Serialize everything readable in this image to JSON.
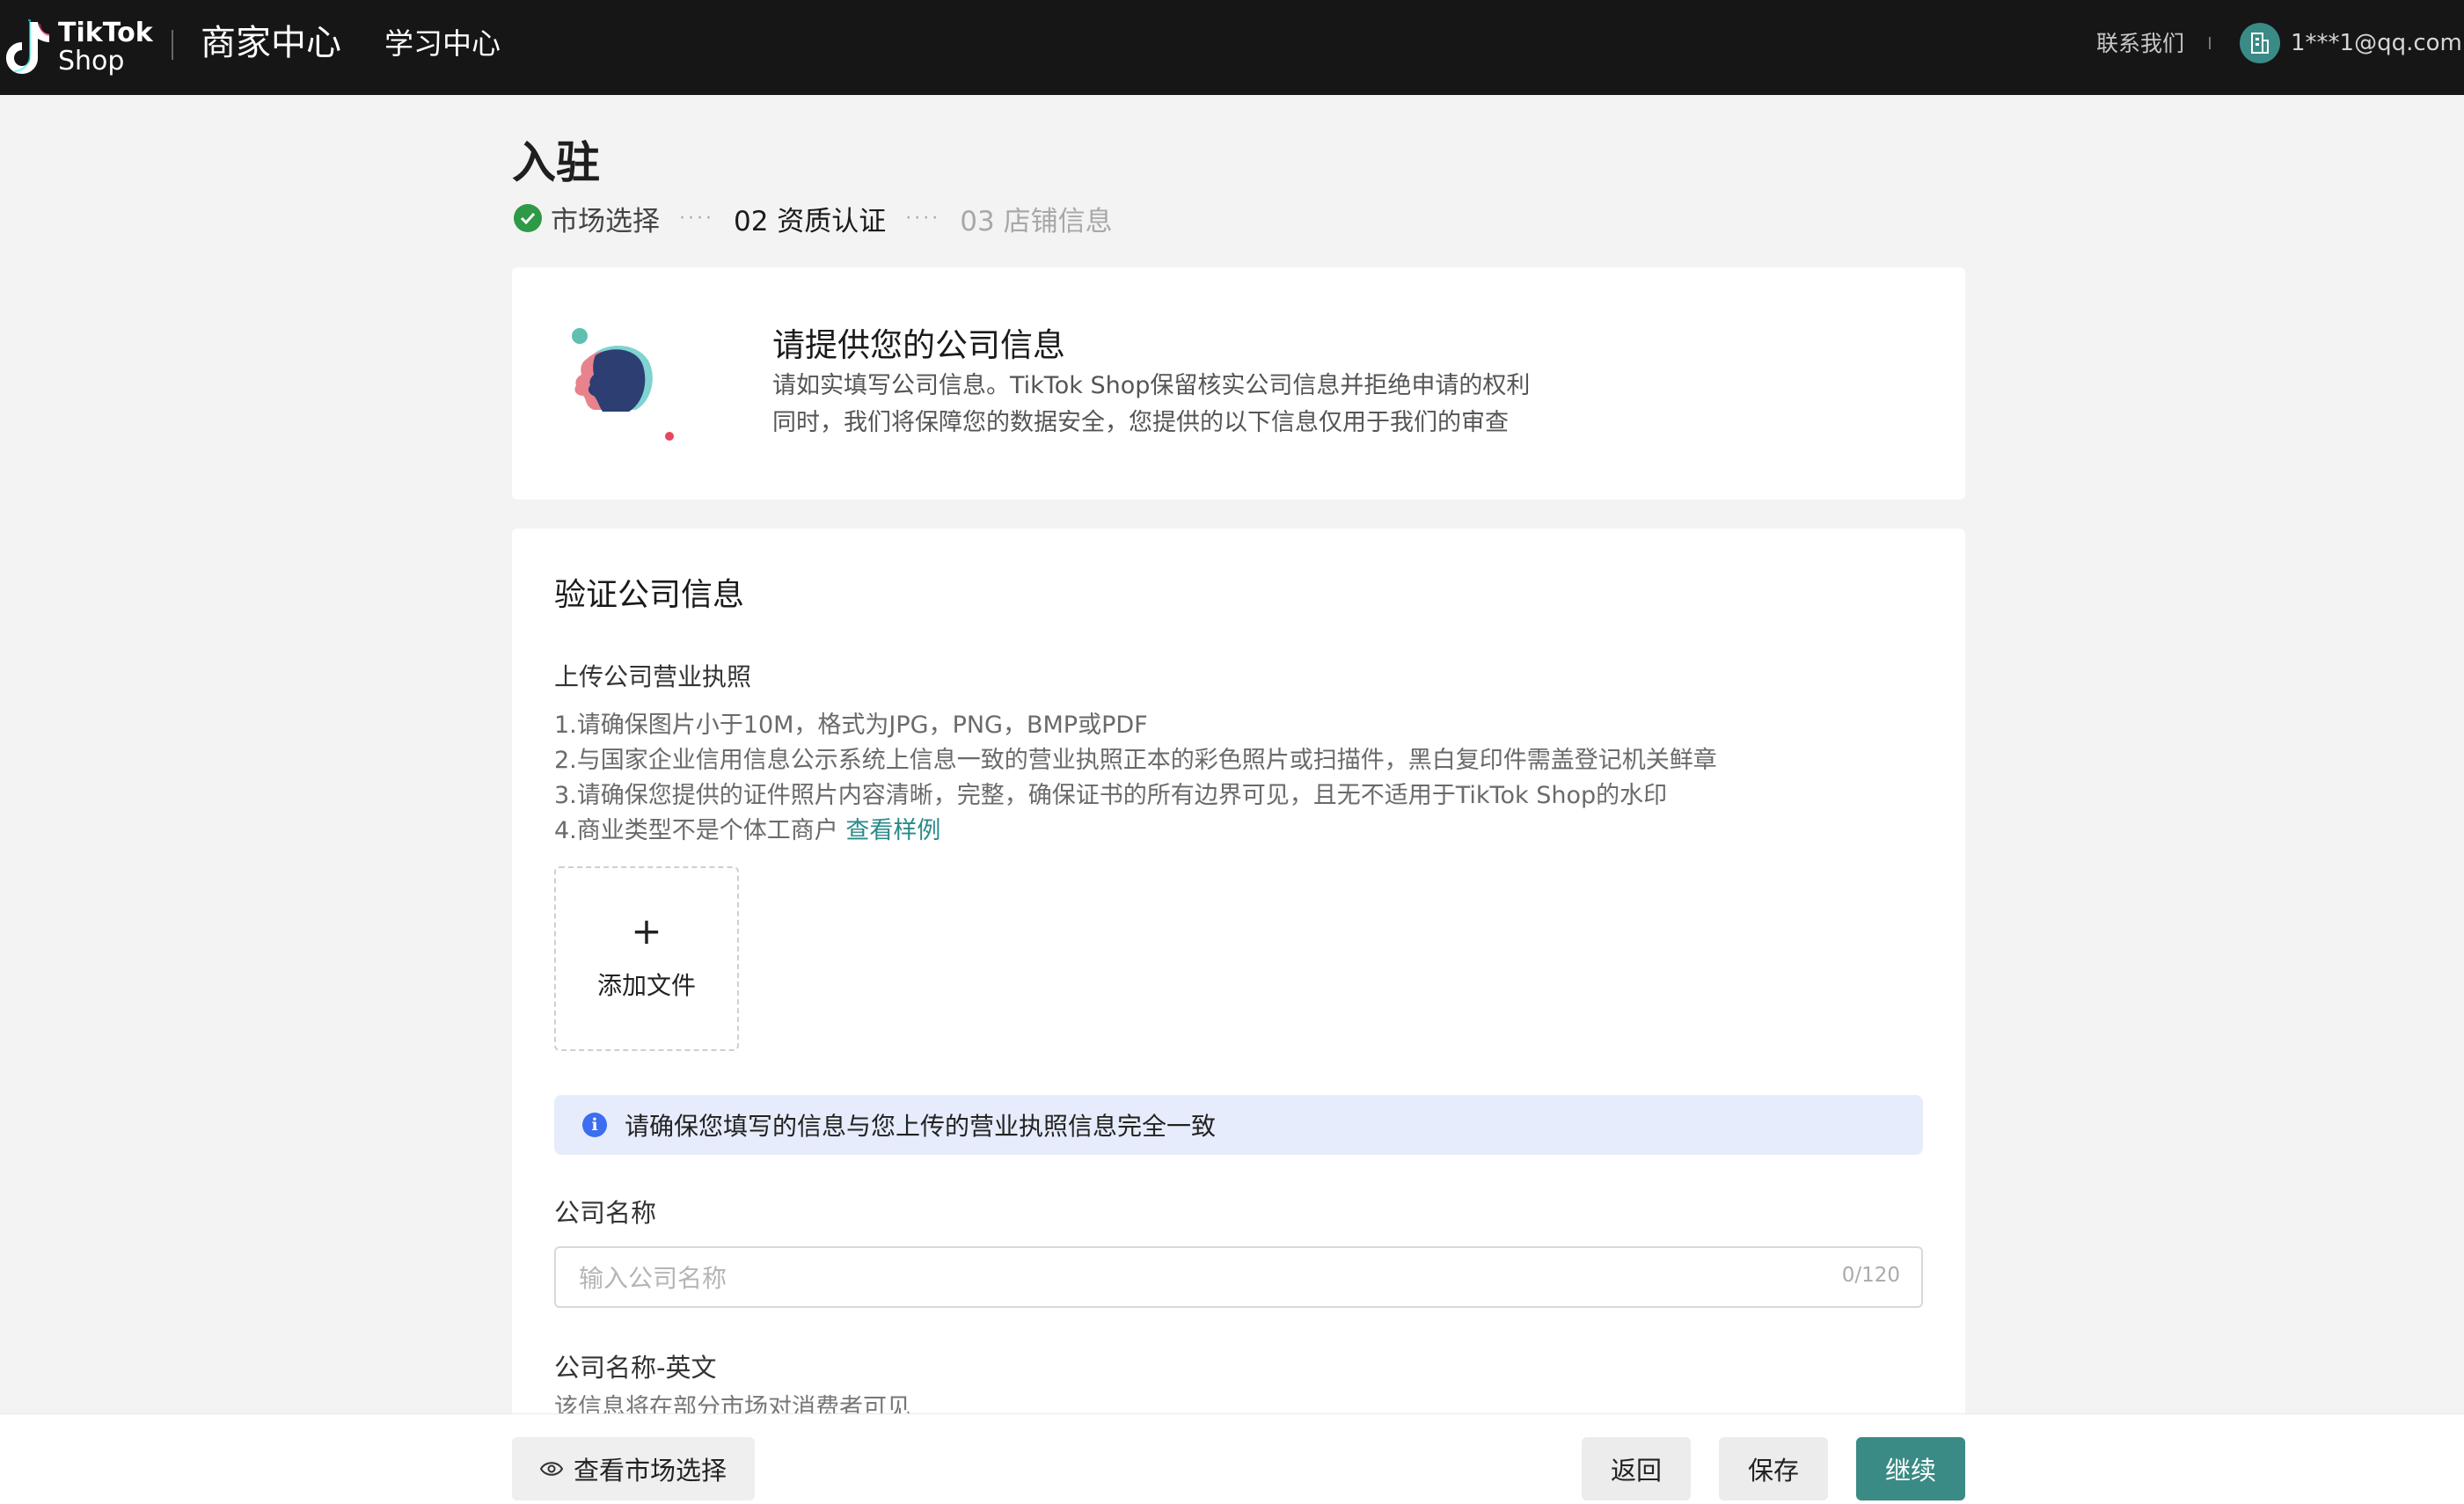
{
  "nav": {
    "logo_line1": "TikTok",
    "logo_line2": "Shop",
    "title": "商家中心",
    "learning_center": "学习中心",
    "contact": "联系我们",
    "account_email": "1***1@qq.com"
  },
  "page": {
    "title": "入驻",
    "steps": [
      {
        "label": "市场选择",
        "status": "done"
      },
      {
        "label": "02 资质认证",
        "status": "active"
      },
      {
        "label": "03 店铺信息",
        "status": "pending"
      }
    ],
    "step_separator": "····"
  },
  "intro": {
    "title": "请提供您的公司信息",
    "line1": "请如实填写公司信息。TikTok Shop保留核实公司信息并拒绝申请的权利",
    "line2": "同时，我们将保障您的数据安全，您提供的以下信息仅用于我们的审查"
  },
  "form": {
    "section_title": "验证公司信息",
    "upload_label": "上传公司营业执照",
    "requirements": [
      "1.请确保图片小于10M，格式为JPG，PNG，BMP或PDF",
      "2.与国家企业信用信息公示系统上信息一致的营业执照正本的彩色照片或扫描件，黑白复印件需盖登记机关鲜章",
      "3.请确保您提供的证件照片内容清晰，完整，确保证书的所有边界可见，且无不适用于TikTok Shop的水印",
      "4.商业类型不是个体工商户 "
    ],
    "sample_link": "查看样例",
    "upload_plus": "+",
    "upload_button": "添加文件",
    "notice": "请确保您填写的信息与您上传的营业执照信息完全一致",
    "company_name_label": "公司名称",
    "company_name_placeholder": "输入公司名称",
    "company_name_value": "",
    "company_name_counter": "0/120",
    "company_name_en_label": "公司名称-英文",
    "company_name_en_hint": "该信息将在部分市场对消费者可见"
  },
  "footer": {
    "view_market": "查看市场选择",
    "back": "返回",
    "save": "保存",
    "continue": "继续"
  },
  "colors": {
    "topbar": "#161616",
    "accent": "#3a8b85",
    "link": "#2b8a8a",
    "success": "#2e9946",
    "notice_bg": "#e6ecfb",
    "info": "#3b6ef0"
  },
  "icons": [
    "tiktok-logo-icon",
    "building-icon",
    "chevron-down-icon",
    "check-circle-icon",
    "info-icon",
    "plus-icon",
    "eye-icon"
  ]
}
